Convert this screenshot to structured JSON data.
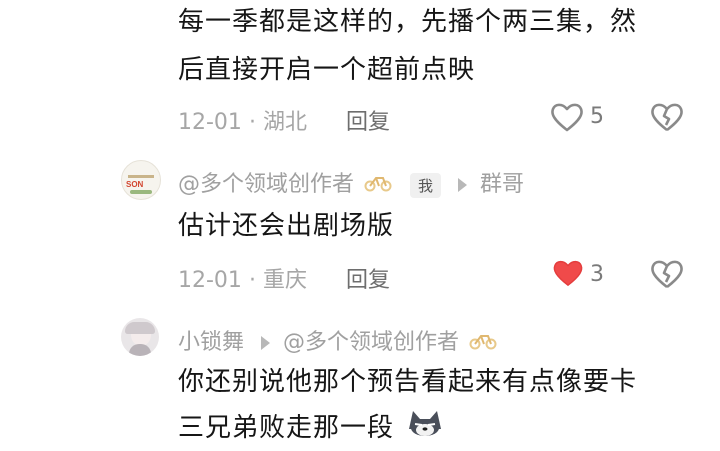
{
  "comments": [
    {
      "text_lines": [
        "每一季都是这样的，先播个两三集，然",
        "后直接开启一个超前点映"
      ],
      "date": "12-01",
      "location": "湖北",
      "reply_label": "回复",
      "likes": "5",
      "liked": false
    },
    {
      "author": "@多个领域创作者",
      "me_badge": "我",
      "reply_to": "群哥",
      "text_lines": [
        "估计还会出剧场版"
      ],
      "date": "12-01",
      "location": "重庆",
      "reply_label": "回复",
      "likes": "3",
      "liked": true,
      "avatar_text": "SON"
    },
    {
      "author": "小锁舞",
      "reply_to": "@多个领域创作者",
      "text_lines": [
        "你还别说他那个预告看起来有点像要卡",
        "三兄弟败走那一段"
      ]
    }
  ],
  "separator": "·",
  "colors": {
    "like_active": "#f04a4a",
    "muted": "#a6a6a6"
  }
}
